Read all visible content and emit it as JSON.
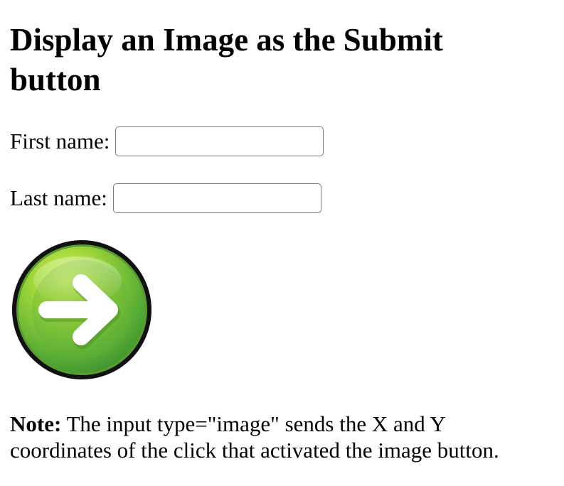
{
  "heading": "Display an Image as the Submit button",
  "form": {
    "first_name": {
      "label": "First name:",
      "value": "",
      "placeholder": ""
    },
    "last_name": {
      "label": "Last name:",
      "value": "",
      "placeholder": ""
    },
    "submit": {
      "icon": "arrow-right-icon",
      "color": "#6cbf34"
    }
  },
  "note": {
    "label": "Note:",
    "text": " The input type=\"image\" sends the X and Y coordinates of the click that activated the image button."
  }
}
